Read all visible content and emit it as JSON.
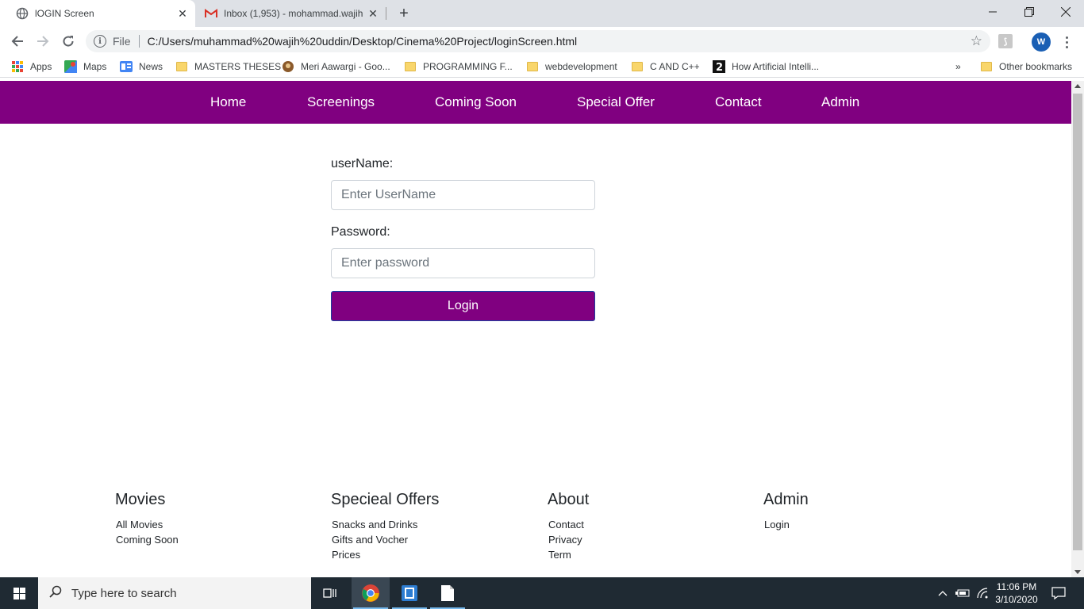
{
  "browser": {
    "tabs": [
      {
        "title": "lOGIN Screen",
        "active": true
      },
      {
        "title": "Inbox (1,953) - mohammad.wajih",
        "active": false
      }
    ],
    "address": {
      "scheme_label": "File",
      "url": "C:/Users/muhammad%20wajih%20uddin/Desktop/Cinema%20Project/loginScreen.html"
    },
    "profile_initial": "W",
    "bookmarks": [
      {
        "label": "Apps",
        "icon": "apps-grid-icon"
      },
      {
        "label": "Maps",
        "icon": "maps-icon"
      },
      {
        "label": "News",
        "icon": "google-news-icon"
      },
      {
        "label": "MASTERS THESES",
        "icon": "folder-icon"
      },
      {
        "label": "Meri Aawargi - Goo...",
        "icon": "blog-icon"
      },
      {
        "label": "PROGRAMMING F...",
        "icon": "folder-icon"
      },
      {
        "label": "webdevelopment",
        "icon": "folder-icon"
      },
      {
        "label": "C AND C++",
        "icon": "folder-icon"
      },
      {
        "label": "How Artificial Intelli...",
        "icon": "quiz-icon"
      }
    ],
    "overflow_label": "»",
    "other_bookmarks": "Other bookmarks"
  },
  "site": {
    "nav": [
      "Home",
      "Screenings",
      "Coming Soon",
      "Special Offer",
      "Contact",
      "Admin"
    ],
    "login": {
      "username_label": "userName:",
      "username_placeholder": "Enter UserName",
      "password_label": "Password:",
      "password_placeholder": "Enter password",
      "submit_label": "Login"
    },
    "footer": [
      {
        "heading": "Movies",
        "links": [
          "All Movies",
          "Coming Soon"
        ]
      },
      {
        "heading": "Specieal Offers",
        "links": [
          "Snacks and Drinks",
          "Gifts and Vocher",
          "Prices"
        ]
      },
      {
        "heading": "About",
        "links": [
          "Contact",
          "Privacy",
          "Term"
        ]
      },
      {
        "heading": "Admin",
        "links": [
          "Login"
        ]
      }
    ],
    "accent_color": "#800080"
  },
  "taskbar": {
    "search_placeholder": "Type here to search",
    "time": "11:06 PM",
    "date": "3/10/2020"
  }
}
